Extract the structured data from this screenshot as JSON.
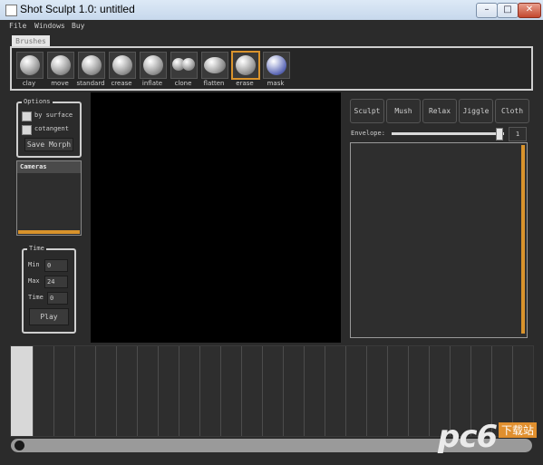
{
  "window": {
    "title": "Shot Sculpt 1.0: untitled"
  },
  "menu": {
    "items": [
      "File",
      "Windows",
      "Buy"
    ]
  },
  "brushes_tab": {
    "label": "Brushes"
  },
  "brushes": [
    {
      "label": "clay"
    },
    {
      "label": "move"
    },
    {
      "label": "standard"
    },
    {
      "label": "crease"
    },
    {
      "label": "inflate"
    },
    {
      "label": "clone"
    },
    {
      "label": "flatten"
    },
    {
      "label": "erase"
    },
    {
      "label": "mask"
    }
  ],
  "options": {
    "title": "Options",
    "by_surface": "by surface",
    "cotangent": "cotangent",
    "save_morph": "Save Morph"
  },
  "cameras": {
    "title": "Cameras"
  },
  "time": {
    "title": "Time",
    "min_label": "Min",
    "min_value": "0",
    "max_label": "Max",
    "max_value": "24",
    "time_label": "Time",
    "time_value": "0",
    "play": "Play"
  },
  "right_buttons": [
    "Sculpt",
    "Mush",
    "Relax",
    "Jiggle",
    "Cloth"
  ],
  "envelope": {
    "label": "Envelope:",
    "value": "1"
  },
  "watermark": {
    "logo": "pc6",
    "site": "下载站"
  }
}
